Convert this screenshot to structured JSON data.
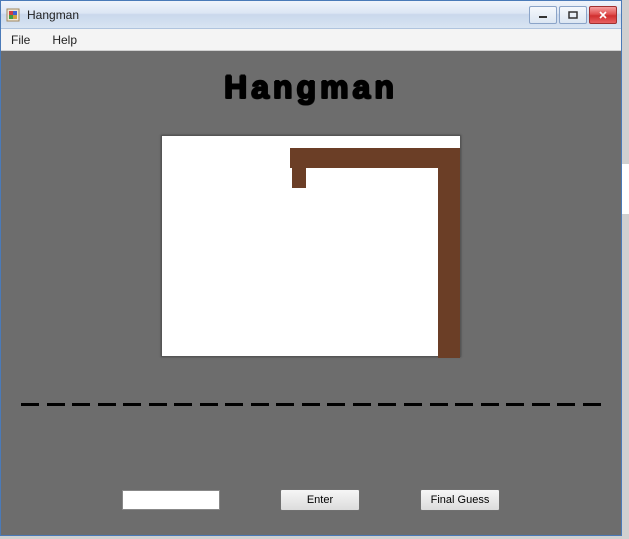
{
  "window": {
    "title": "Hangman"
  },
  "menu": {
    "file": "File",
    "help": "Help"
  },
  "game": {
    "title": "Hangman",
    "word_length": 23,
    "guess_value": "",
    "enter_label": "Enter",
    "final_guess_label": "Final Guess"
  }
}
